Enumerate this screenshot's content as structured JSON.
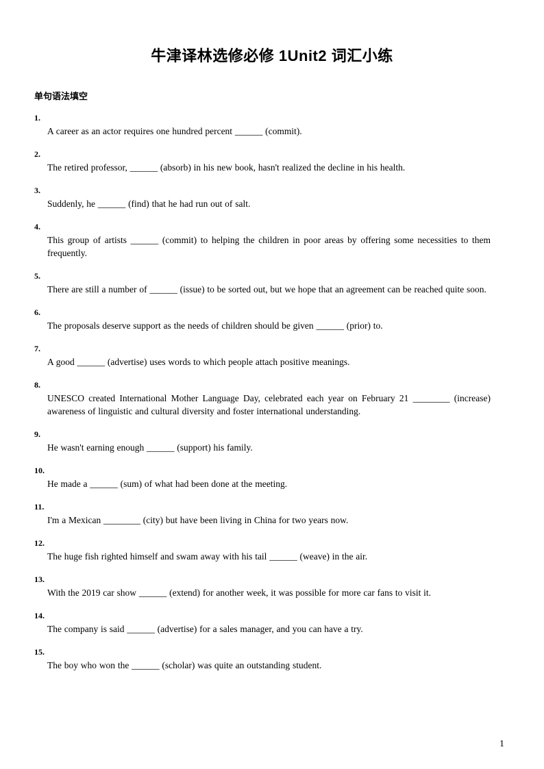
{
  "document": {
    "title": "牛津译林选修必修 1Unit2 词汇小练",
    "page_number": "1"
  },
  "section": {
    "heading": "单句语法填空"
  },
  "questions": [
    {
      "number": "1.",
      "text": "A career as an actor requires one hundred percent ______ (commit).",
      "justify": false
    },
    {
      "number": "2.",
      "text": "The retired professor, ______ (absorb) in his new book, hasn't realized the decline in his health.",
      "justify": false
    },
    {
      "number": "3.",
      "text": "Suddenly, he ______ (find) that he had run out of salt.",
      "justify": false
    },
    {
      "number": "4.",
      "text": "This group of artists ______ (commit) to helping the children in poor areas by offering some necessities to them frequently.",
      "justify": true
    },
    {
      "number": "5.",
      "text": "There are still a number of ______ (issue) to be sorted out, but we hope that an agreement can be reached quite soon.",
      "justify": true
    },
    {
      "number": "6.",
      "text": "The proposals deserve support as the needs of children should be given ______ (prior) to.",
      "justify": false
    },
    {
      "number": "7.",
      "text": "A good ______ (advertise) uses words to which people attach positive meanings.",
      "justify": false
    },
    {
      "number": "8.",
      "text": "UNESCO created International Mother Language Day, celebrated each year on February 21 ________ (increase) awareness of linguistic and cultural diversity and foster international understanding.",
      "justify": true
    },
    {
      "number": "9.",
      "text": "He wasn't earning enough ______ (support) his family.",
      "justify": false
    },
    {
      "number": "10.",
      "text": "He made a ______ (sum) of what had been done at the meeting.",
      "justify": false
    },
    {
      "number": "11.",
      "text": "I'm a Mexican ________ (city) but have been living in China for two years now.",
      "justify": false
    },
    {
      "number": "12.",
      "text": "The huge fish righted himself and swam away with his tail ______ (weave) in the air.",
      "justify": false
    },
    {
      "number": "13.",
      "text": "With the 2019 car show ______ (extend) for another week, it was possible for more car fans to visit it.",
      "justify": false
    },
    {
      "number": "14.",
      "text": "The company is said ______ (advertise) for a sales manager, and you can have a try.",
      "justify": false
    },
    {
      "number": "15.",
      "text": "The boy who won the ______ (scholar) was quite an outstanding student.",
      "justify": false
    }
  ]
}
